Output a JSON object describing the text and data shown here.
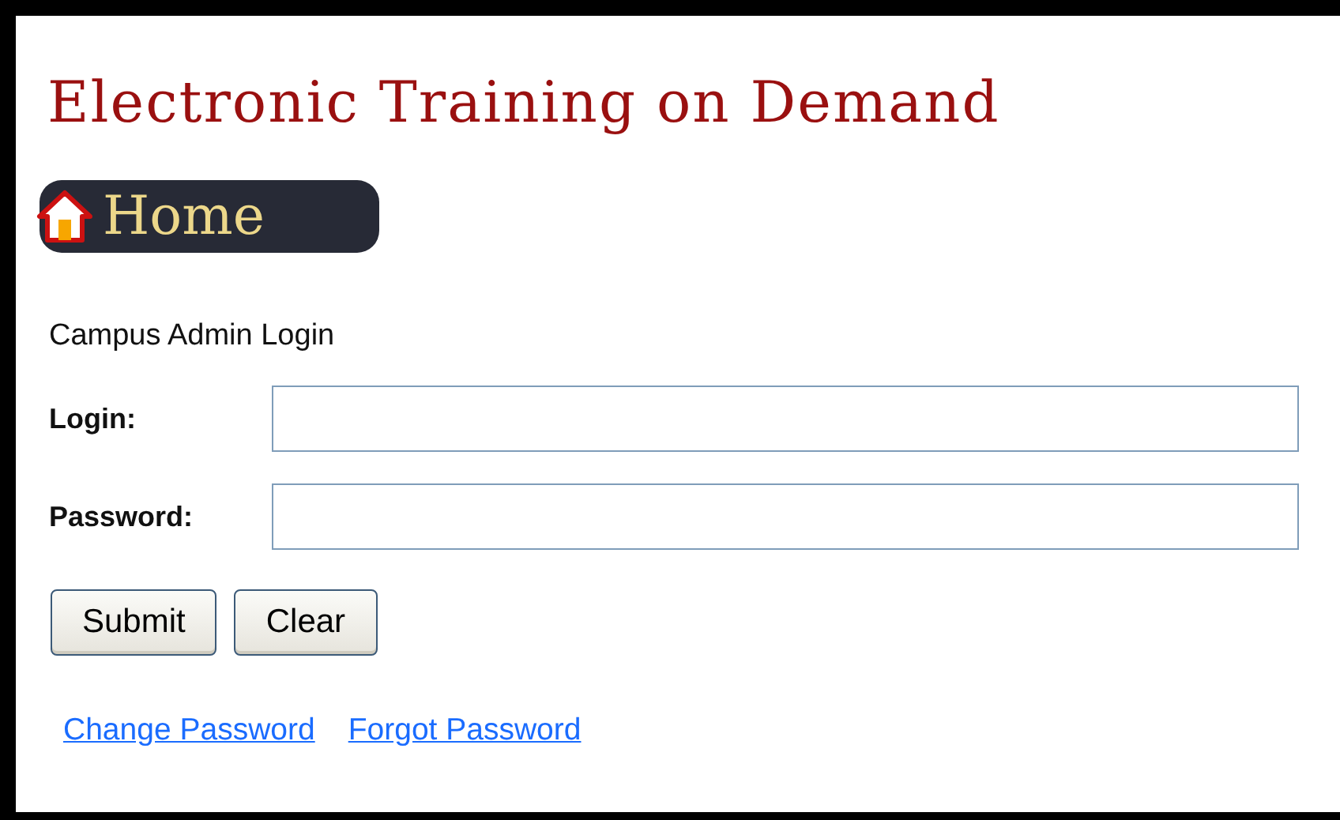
{
  "title": "Electronic Training on Demand",
  "home_button": {
    "label": "Home"
  },
  "heading": "Campus Admin Login",
  "fields": [
    {
      "label": "Login:"
    },
    {
      "label": "Password:"
    }
  ],
  "buttons": [
    "Submit",
    "Clear"
  ],
  "links": [
    "Change Password",
    "Forgot Password"
  ]
}
